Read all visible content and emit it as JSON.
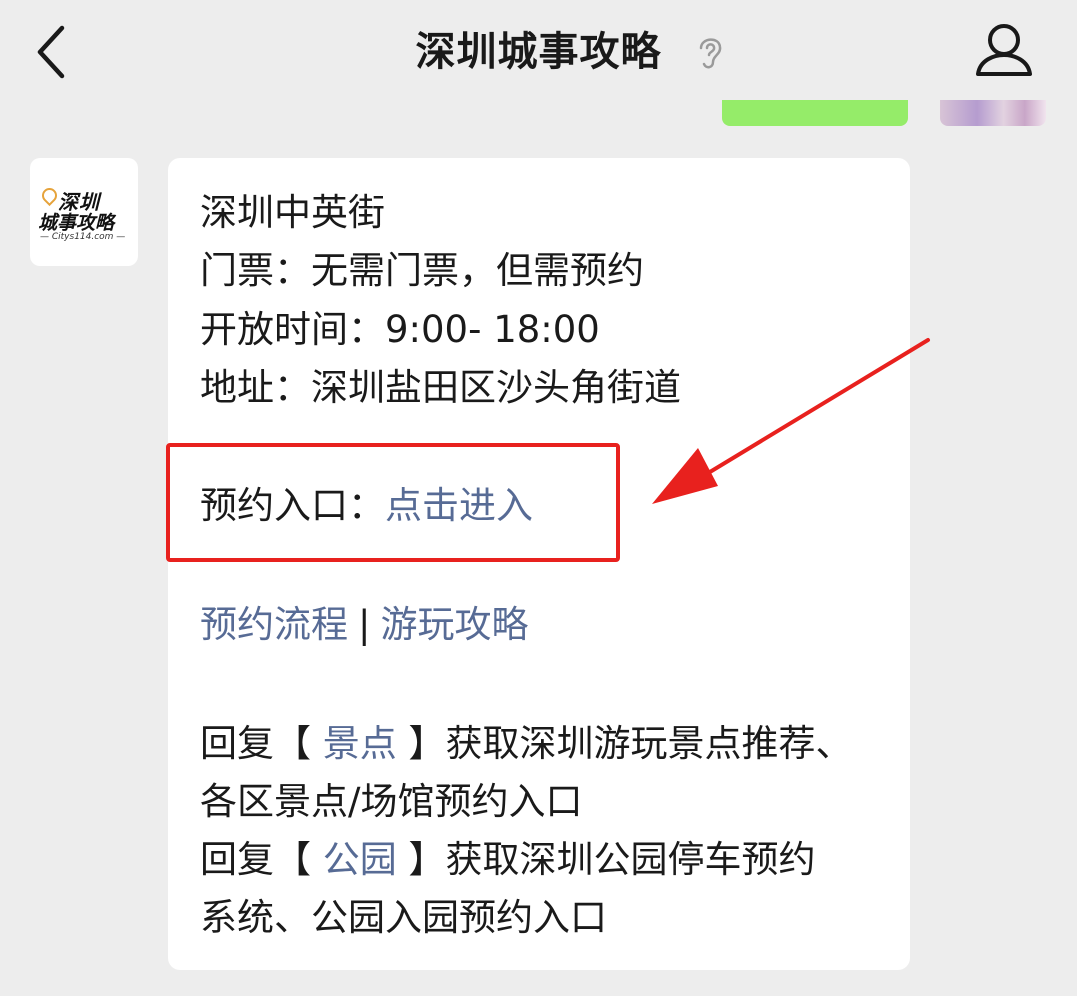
{
  "header": {
    "title": "深圳城事攻略",
    "back_icon": "chevron-left-icon",
    "ear_icon": "ear-icon",
    "profile_icon": "person-icon"
  },
  "avatar": {
    "logo_line1": "深圳",
    "logo_line2": "城事攻略",
    "logo_site": "— Citys114.com —"
  },
  "message": {
    "line1": "深圳中英街",
    "line2": "门票：无需门票，但需预约",
    "line3": "开放时间：9:00- 18:00",
    "line4": "地址：深圳盐田区沙头角街道",
    "booking_label": "预约入口：",
    "booking_link": "点击进入",
    "process_link": "预约流程",
    "divider": "|",
    "guide_link": "游玩攻略",
    "reply1_prefix": "回复【 ",
    "reply1_keyword": "景点",
    "reply1_suffix": " 】获取深圳游玩景点推荐、",
    "reply1_line2": "各区景点/场馆预约入口",
    "reply2_prefix": "回复【 ",
    "reply2_keyword": "公园",
    "reply2_suffix": " 】获取深圳公园停车预约",
    "reply2_line2": "系统、公园入园预约入口"
  },
  "colors": {
    "background": "#ededed",
    "bubble": "#ffffff",
    "link": "#576b95",
    "highlight_box": "#e8211e",
    "sent_bubble": "#95ec69"
  }
}
